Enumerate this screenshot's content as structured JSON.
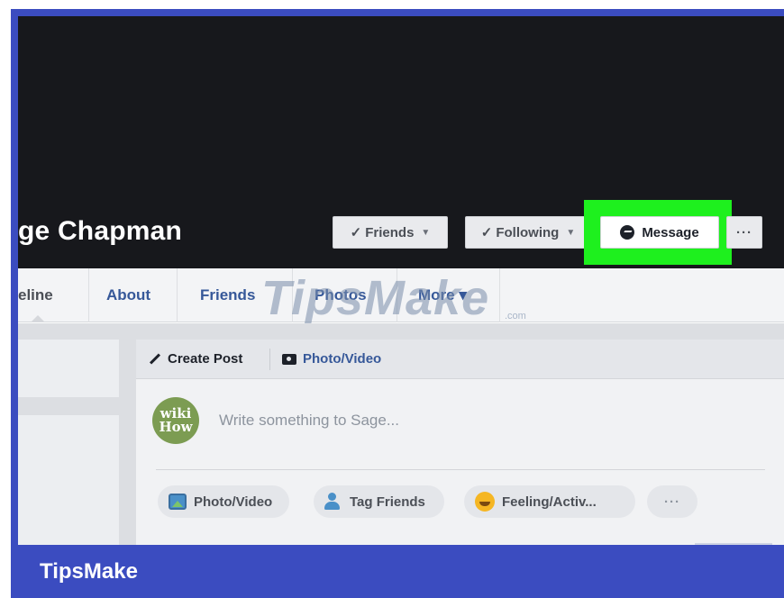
{
  "profile": {
    "name": "ge Chapman"
  },
  "cover_actions": {
    "friends_label": "Friends",
    "following_label": "Following",
    "message_label": "Message",
    "more_label": "···"
  },
  "nav": {
    "items": [
      {
        "label": "eline"
      },
      {
        "label": "About"
      },
      {
        "label": "Friends"
      },
      {
        "label": "Photos"
      },
      {
        "label": "More ▾"
      }
    ]
  },
  "composer": {
    "tabs": [
      {
        "label": "Create Post",
        "icon": "pencil-icon"
      },
      {
        "label": "Photo/Video",
        "icon": "camera-icon"
      }
    ],
    "avatar_text": [
      "wiki",
      "How"
    ],
    "placeholder": "Write something to Sage...",
    "actions": [
      {
        "label": "Photo/Video",
        "icon": "photo-icon"
      },
      {
        "label": "Tag Friends",
        "icon": "tag-friends-icon"
      },
      {
        "label": "Feeling/Activ...",
        "icon": "smile-icon"
      },
      {
        "label": "···"
      }
    ]
  },
  "watermark": {
    "text": "TipsMake",
    "suffix": ".com"
  },
  "footer": {
    "brand": "TipsMake"
  },
  "colors": {
    "frame": "#3b4cc0",
    "cover": "#17181c",
    "highlight": "#1ef01e",
    "link": "#365899"
  }
}
